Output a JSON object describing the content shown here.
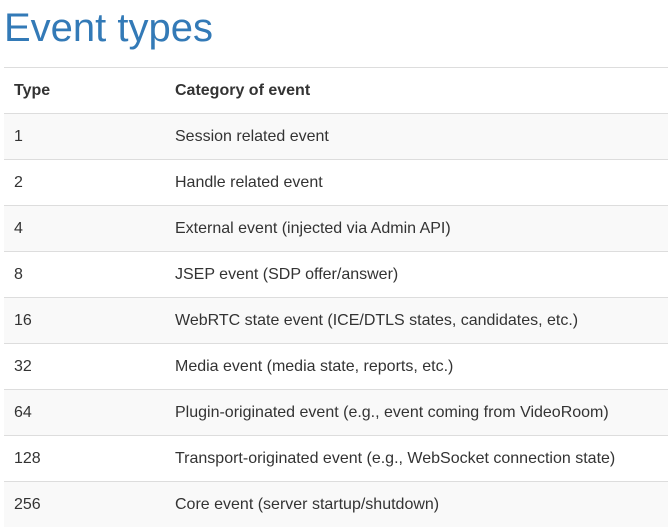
{
  "title": "Event types",
  "table": {
    "headers": {
      "type": "Type",
      "category": "Category of event"
    },
    "rows": [
      {
        "type": "1",
        "category": "Session related event"
      },
      {
        "type": "2",
        "category": "Handle related event"
      },
      {
        "type": "4",
        "category": "External event (injected via Admin API)"
      },
      {
        "type": "8",
        "category": "JSEP event (SDP offer/answer)"
      },
      {
        "type": "16",
        "category": "WebRTC state event (ICE/DTLS states, candidates, etc.)"
      },
      {
        "type": "32",
        "category": "Media event (media state, reports, etc.)"
      },
      {
        "type": "64",
        "category": "Plugin-originated event (e.g., event coming from VideoRoom)"
      },
      {
        "type": "128",
        "category": "Transport-originated event (e.g., WebSocket connection state)"
      },
      {
        "type": "256",
        "category": "Core event (server startup/shutdown)"
      }
    ]
  },
  "colors": {
    "title": "#337ab7",
    "text": "#333333",
    "border": "#dddddd",
    "stripe": "#f9f9f9"
  }
}
